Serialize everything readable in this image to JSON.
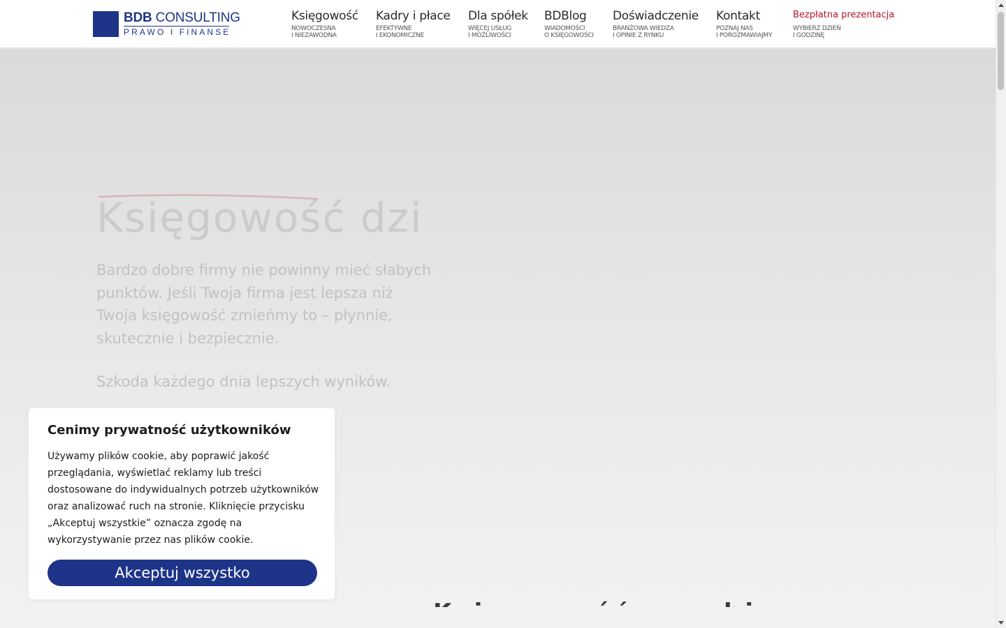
{
  "header": {
    "logo": {
      "main_bold": "BDB",
      "main_rest": "CONSULTING",
      "sub": "PRAWO I FINANSE"
    },
    "nav": [
      {
        "label": "Księgowość",
        "sub1": "NOWOCZESNA",
        "sub2": "I NIEZAWODNA"
      },
      {
        "label": "Kadry i płace",
        "sub1": "EFEKTYWNE",
        "sub2": "I EKONOMICZNE"
      },
      {
        "label": "Dla spółek",
        "sub1": "WIĘCEJ USŁUG",
        "sub2": "I MOŻLIWOŚCI"
      },
      {
        "label": "BDBlog",
        "sub1": "WIADOMOŚCI",
        "sub2": "O KSIĘGOWOŚCI"
      },
      {
        "label": "Doświadczenie",
        "sub1": "BRANŻOWA WIEDZA",
        "sub2": "I OPINIE Z RYNKU"
      },
      {
        "label": "Kontakt",
        "sub1": "POZNAJ NAS",
        "sub2": "I POROZMAWIAJMY"
      },
      {
        "label": "Bezpłatna prezentacja",
        "sub1": "WYBIERZ DZIEŃ",
        "sub2": "I GODZINĘ"
      }
    ]
  },
  "hero": {
    "heading": "Księgowość dzi",
    "text": "Bardzo dobre firmy nie powinny mieć słabych punktów. Jeśli Twoja firma jest lepsza niż Twoja księgowość zmieńmy to – płynnie, skutecznie i bezpiecznie.",
    "subtext": "Szkoda każdego dnia lepszych wyników.",
    "bottom_heading": "Księgowość z ambicjami"
  },
  "cookie": {
    "title": "Cenimy prywatność użytkowników",
    "body": "Używamy plików cookie, aby poprawić jakość przeglądania, wyświetlać reklamy lub treści dostosowane do indywidualnych potrzeb użytkowników oraz analizować ruch na stronie. Kliknięcie przycisku „Akceptuj wszystkie” oznacza zgodę na wykorzystywanie przez nas plików cookie.",
    "button": "Akceptuj wszystko"
  },
  "colors": {
    "brand": "#1e3489",
    "accent": "#b7122d"
  }
}
